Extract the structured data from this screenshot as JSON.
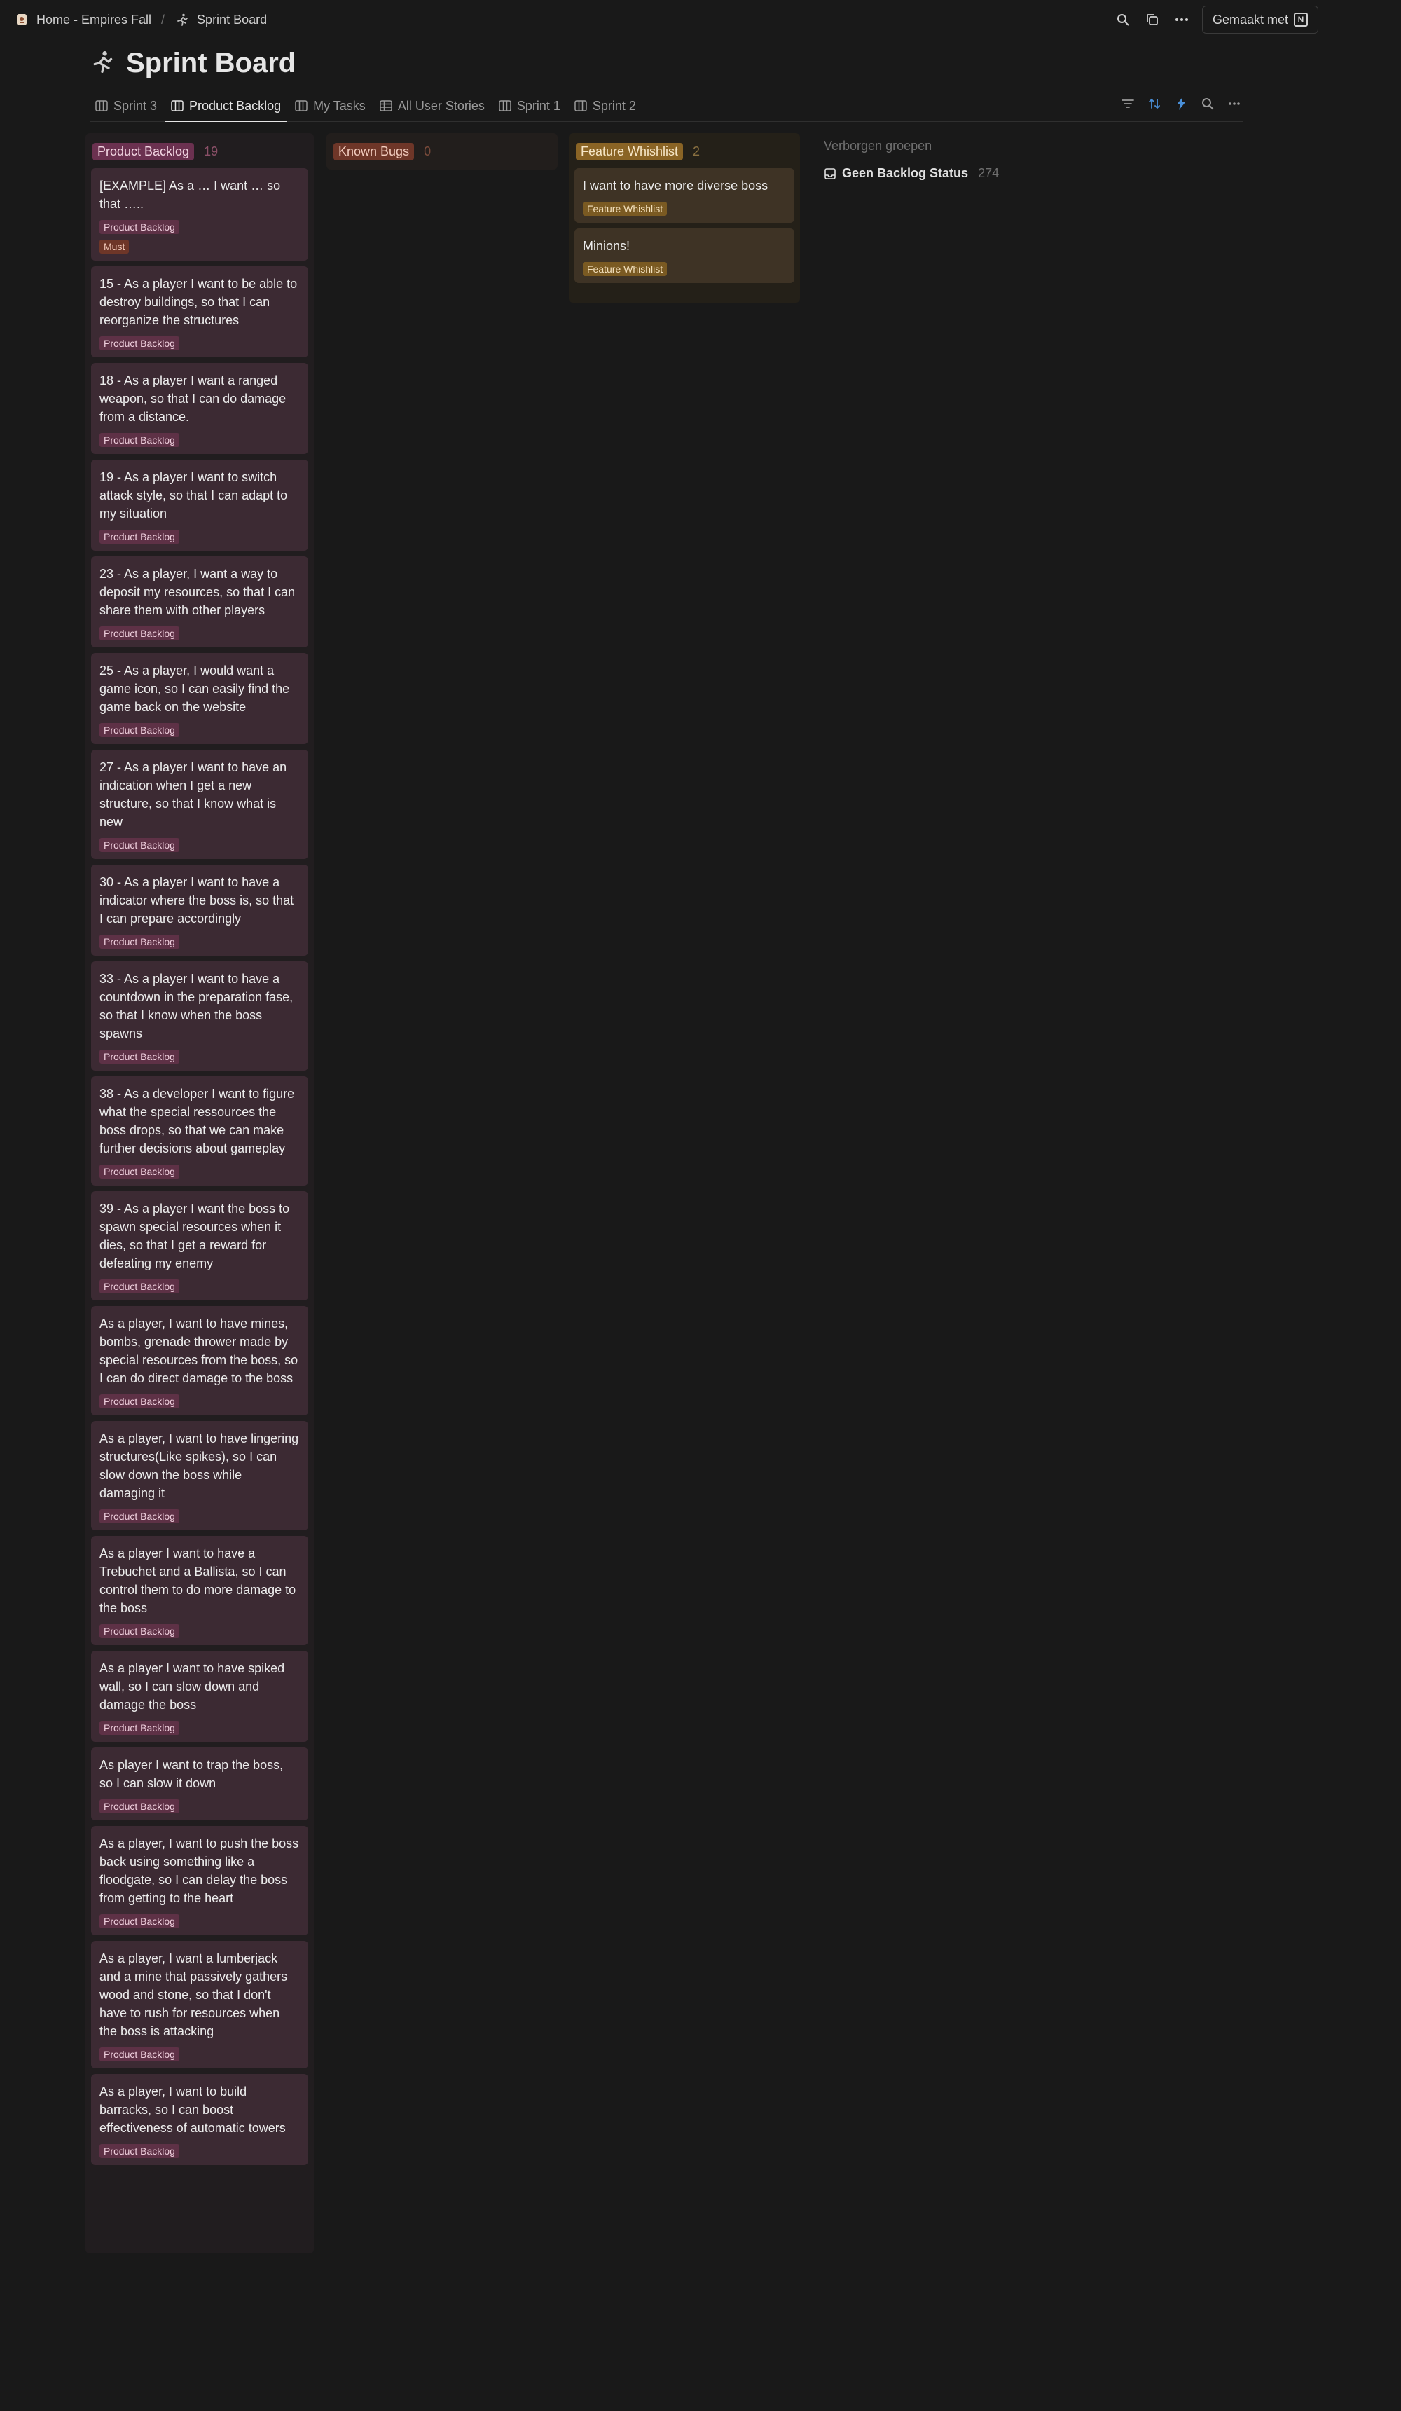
{
  "breadcrumb": {
    "home": "Home - Empires Fall",
    "separator": "/",
    "current": "Sprint Board"
  },
  "topbar": {
    "made_with": "Gemaakt met",
    "icons": [
      "search-icon",
      "duplicate-icon",
      "more-icon"
    ]
  },
  "page": {
    "title": "Sprint Board",
    "icon": "runner-icon"
  },
  "tabs": [
    {
      "label": "Sprint 3",
      "icon": "board-icon"
    },
    {
      "label": "Product Backlog",
      "icon": "board-icon",
      "active": true
    },
    {
      "label": "My Tasks",
      "icon": "board-icon"
    },
    {
      "label": "All User Stories",
      "icon": "table-icon"
    },
    {
      "label": "Sprint 1",
      "icon": "board-icon"
    },
    {
      "label": "Sprint 2",
      "icon": "board-icon"
    }
  ],
  "tools": [
    "filter-icon",
    "sort-icon",
    "automation-icon",
    "search-icon",
    "more-icon"
  ],
  "columns": {
    "product_backlog": {
      "name": "Product Backlog",
      "count": "19",
      "color": "#6b3150",
      "cards": [
        {
          "title": "[EXAMPLE] As a … I want … so that …..",
          "badge": "Product Backlog",
          "badge2": "Must"
        },
        {
          "title": "15 - As a player I want to be able to destroy buildings, so that I can reorganize the structures",
          "badge": "Product Backlog"
        },
        {
          "title": "18 - As a player I want a ranged weapon, so that I can do damage from a distance.",
          "badge": "Product Backlog"
        },
        {
          "title": "19 - As a player I want to switch attack style, so that I can adapt to my situation",
          "badge": "Product Backlog"
        },
        {
          "title": "23 - As a player, I want a way to deposit my resources, so that I can share them with other players",
          "badge": "Product Backlog"
        },
        {
          "title": "25 - As a player, I would want a game icon, so I can easily find the game back on the website",
          "badge": "Product Backlog"
        },
        {
          "title": "27 - As a player I want to have an indication when I get a new structure, so that I know what is new",
          "badge": "Product Backlog"
        },
        {
          "title": "30 - As a player I want to have a indicator where the boss is, so that I can prepare accordingly",
          "badge": "Product Backlog"
        },
        {
          "title": "33 - As a player I want to have a countdown in the preparation fase, so that I know when the boss spawns",
          "badge": "Product Backlog"
        },
        {
          "title": "38 - As a developer I want to figure what the special ressources the boss drops, so that we can make further decisions about gameplay",
          "badge": "Product Backlog"
        },
        {
          "title": "39 - As a player I want the boss to spawn special resources when it dies, so that I get a reward for defeating my enemy",
          "badge": "Product Backlog"
        },
        {
          "title": "As a player, I want to have mines, bombs, grenade thrower made by special resources from the boss, so I can do direct damage to the boss",
          "badge": "Product Backlog"
        },
        {
          "title": "As a player, I want to have lingering structures(Like spikes), so I can slow down the boss while damaging it",
          "badge": "Product Backlog"
        },
        {
          "title": "As a player I want to have a Trebuchet and a Ballista, so I can control them to do more damage to the boss",
          "badge": "Product Backlog"
        },
        {
          "title": "As a player I want to have spiked wall, so I can slow down and damage the boss",
          "badge": "Product Backlog"
        },
        {
          "title": "As player I want to trap the boss, so I can slow it down",
          "badge": "Product Backlog"
        },
        {
          "title": "As a player, I want to push the boss back using something like a floodgate, so I can delay the boss from getting to the heart",
          "badge": "Product Backlog"
        },
        {
          "title": "As a player, I want a lumberjack and a mine that passively gathers wood and stone, so that I don't have to rush for resources when the boss is attacking",
          "badge": "Product Backlog"
        },
        {
          "title": "As a player, I want to build barracks, so I can boost effectiveness of automatic towers",
          "badge": "Product Backlog"
        }
      ]
    },
    "known_bugs": {
      "name": "Known Bugs",
      "count": "0",
      "color": "#6e3628"
    },
    "feature_whishlist": {
      "name": "Feature Whishlist",
      "count": "2",
      "color": "#8a6425",
      "cards": [
        {
          "title": "I want to have more diverse boss",
          "badge": "Feature Whishlist"
        },
        {
          "title": "Minions!",
          "badge": "Feature Whishlist"
        }
      ]
    }
  },
  "hidden_groups": {
    "title": "Verborgen groepen",
    "item": {
      "label": "Geen Backlog Status",
      "count": "274",
      "icon": "inbox-icon"
    }
  }
}
